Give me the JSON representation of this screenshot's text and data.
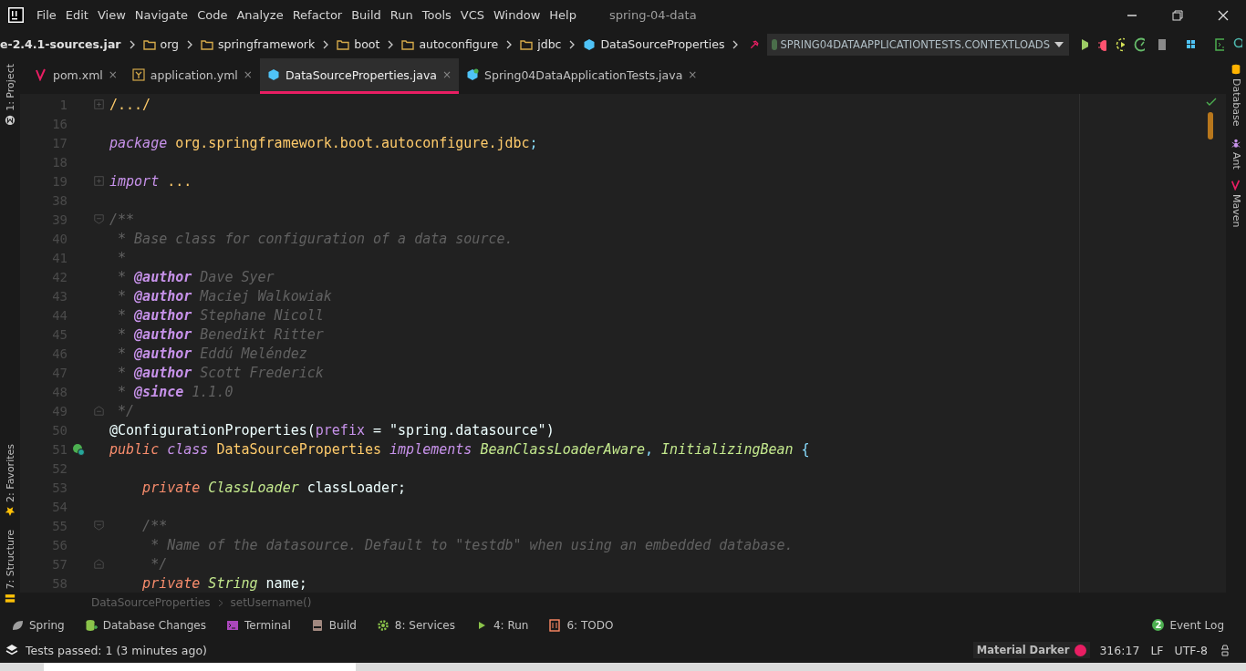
{
  "window": {
    "title": "spring-04-data"
  },
  "menu": [
    "File",
    "Edit",
    "View",
    "Navigate",
    "Code",
    "Analyze",
    "Refactor",
    "Build",
    "Run",
    "Tools",
    "VCS",
    "Window",
    "Help"
  ],
  "navbar": {
    "crumbs": [
      {
        "label": "e-2.4.1-sources.jar",
        "kind": "jar"
      },
      {
        "label": "org",
        "kind": "folder"
      },
      {
        "label": "springframework",
        "kind": "folder"
      },
      {
        "label": "boot",
        "kind": "folder"
      },
      {
        "label": "autoconfigure",
        "kind": "folder"
      },
      {
        "label": "jdbc",
        "kind": "folder"
      },
      {
        "label": "DataSourceProperties",
        "kind": "class"
      }
    ],
    "run_config": "SPRING04DATAAPPLICATIONTESTS.CONTEXTLOADS"
  },
  "left_stripe": [
    {
      "label": "1: Project",
      "kind": "project"
    },
    {
      "label": "2: Favorites",
      "kind": "favorites"
    },
    {
      "label": "7: Structure",
      "kind": "structure"
    }
  ],
  "right_stripe": [
    {
      "label": "Database",
      "kind": "database"
    },
    {
      "label": "Ant",
      "kind": "ant"
    },
    {
      "label": "Maven",
      "kind": "maven"
    }
  ],
  "tabs": [
    {
      "label": "pom.xml",
      "kind": "maven",
      "selected": false,
      "close": "×"
    },
    {
      "label": "application.yml",
      "kind": "yaml",
      "selected": false,
      "close": "×"
    },
    {
      "label": "DataSourceProperties.java",
      "kind": "class",
      "selected": true,
      "close": "×"
    },
    {
      "label": "Spring04DataApplicationTests.java",
      "kind": "test",
      "selected": false,
      "close": "×"
    }
  ],
  "code": [
    {
      "number": "1",
      "fold": {
        "kind": "collapsed"
      },
      "tokens": [
        {
          "text": "/.../",
          "kind": "folded"
        }
      ]
    },
    {
      "number": "16"
    },
    {
      "number": "17",
      "tokens": [
        {
          "text": "package",
          "kind": "keyword"
        },
        {
          "text": " org.springframework.boot.autoconfigure.jdbc",
          "kind": "package"
        },
        {
          "text": ";",
          "kind": "punct"
        }
      ]
    },
    {
      "number": "18"
    },
    {
      "number": "19",
      "fold": {
        "kind": "collapsed"
      },
      "tokens": [
        {
          "text": "import",
          "kind": "keyword"
        },
        {
          "text": " ...",
          "kind": "folded"
        }
      ]
    },
    {
      "number": "38"
    },
    {
      "number": "39",
      "fold": {
        "kind": "open"
      },
      "tokens": [
        {
          "text": "/**",
          "kind": "comment"
        }
      ]
    },
    {
      "number": "40",
      "tokens": [
        {
          "text": " * Base class for configuration of a data source.",
          "kind": "comment"
        }
      ]
    },
    {
      "number": "41",
      "tokens": [
        {
          "text": " *",
          "kind": "comment"
        }
      ]
    },
    {
      "number": "42",
      "tokens": [
        {
          "text": " * ",
          "kind": "comment"
        },
        {
          "text": "@author",
          "kind": "doctag"
        },
        {
          "text": " Dave Syer",
          "kind": "comment"
        }
      ]
    },
    {
      "number": "43",
      "tokens": [
        {
          "text": " * ",
          "kind": "comment"
        },
        {
          "text": "@author",
          "kind": "doctag"
        },
        {
          "text": " Maciej Walkowiak",
          "kind": "comment"
        }
      ]
    },
    {
      "number": "44",
      "tokens": [
        {
          "text": " * ",
          "kind": "comment"
        },
        {
          "text": "@author",
          "kind": "doctag"
        },
        {
          "text": " Stephane Nicoll",
          "kind": "comment"
        }
      ]
    },
    {
      "number": "45",
      "tokens": [
        {
          "text": " * ",
          "kind": "comment"
        },
        {
          "text": "@author",
          "kind": "doctag"
        },
        {
          "text": " Benedikt Ritter",
          "kind": "comment"
        }
      ]
    },
    {
      "number": "46",
      "tokens": [
        {
          "text": " * ",
          "kind": "comment"
        },
        {
          "text": "@author",
          "kind": "doctag"
        },
        {
          "text": " Eddú Meléndez",
          "kind": "comment"
        }
      ]
    },
    {
      "number": "47",
      "tokens": [
        {
          "text": " * ",
          "kind": "comment"
        },
        {
          "text": "@author",
          "kind": "doctag"
        },
        {
          "text": " Scott Frederick",
          "kind": "comment"
        }
      ]
    },
    {
      "number": "48",
      "tokens": [
        {
          "text": " * ",
          "kind": "comment"
        },
        {
          "text": "@since",
          "kind": "doctag"
        },
        {
          "text": " 1.1.0",
          "kind": "comment"
        }
      ]
    },
    {
      "number": "49",
      "fold": {
        "kind": "end"
      },
      "tokens": [
        {
          "text": " */",
          "kind": "comment"
        }
      ]
    },
    {
      "number": "50",
      "tokens": [
        {
          "text": "@ConfigurationProperties(",
          "kind": "plain"
        },
        {
          "text": "prefix",
          "kind": "param"
        },
        {
          "text": " = ",
          "kind": "plain"
        },
        {
          "text": "\"spring.datasource\"",
          "kind": "string"
        },
        {
          "text": ")",
          "kind": "plain"
        }
      ]
    },
    {
      "number": "51",
      "gutter_icon": {
        "kind": "bean"
      },
      "tokens": [
        {
          "text": "public",
          "kind": "modifier"
        },
        {
          "text": " class",
          "kind": "keyword"
        },
        {
          "text": " DataSourceProperties ",
          "kind": "package"
        },
        {
          "text": "implements",
          "kind": "keyword"
        },
        {
          "text": " BeanClassLoaderAware",
          "kind": "type"
        },
        {
          "text": ", ",
          "kind": "punct"
        },
        {
          "text": "InitializingBean",
          "kind": "type"
        },
        {
          "text": " {",
          "kind": "punct"
        }
      ]
    },
    {
      "number": "52"
    },
    {
      "number": "53",
      "tokens": [
        {
          "text": "    private",
          "kind": "modifier"
        },
        {
          "text": " ClassLoader",
          "kind": "type"
        },
        {
          "text": " classLoader;",
          "kind": "plain"
        }
      ]
    },
    {
      "number": "54"
    },
    {
      "number": "55",
      "fold": {
        "kind": "open"
      },
      "tokens": [
        {
          "text": "    /**",
          "kind": "comment"
        }
      ]
    },
    {
      "number": "56",
      "tokens": [
        {
          "text": "     * Name of the datasource. Default to \"testdb\" when using an embedded database.",
          "kind": "comment"
        }
      ]
    },
    {
      "number": "57",
      "fold": {
        "kind": "end"
      },
      "tokens": [
        {
          "text": "     */",
          "kind": "comment"
        }
      ]
    },
    {
      "number": "58",
      "tokens": [
        {
          "text": "    private",
          "kind": "modifier"
        },
        {
          "text": " String",
          "kind": "type"
        },
        {
          "text": " name;",
          "kind": "plain"
        }
      ]
    }
  ],
  "editor_breadcrumb": [
    "DataSourceProperties",
    "setUsername()"
  ],
  "tool_windows": [
    {
      "label": "Spring",
      "kind": "spring"
    },
    {
      "label": "Database Changes",
      "kind": "database"
    },
    {
      "label": "Terminal",
      "kind": "terminal"
    },
    {
      "label": "Build",
      "kind": "build"
    },
    {
      "label": "8: Services",
      "kind": "services"
    },
    {
      "label": "4: Run",
      "kind": "run"
    },
    {
      "label": "6: TODO",
      "kind": "todo"
    }
  ],
  "event_log": {
    "label": "Event Log",
    "count": "2"
  },
  "status_bar": {
    "message": "Tests passed: 1 (3 minutes ago)",
    "theme": {
      "label": "Material Darker",
      "color": "#e91e63"
    },
    "position": "316:17",
    "line_separator": "LF",
    "encoding": "UTF-8"
  }
}
